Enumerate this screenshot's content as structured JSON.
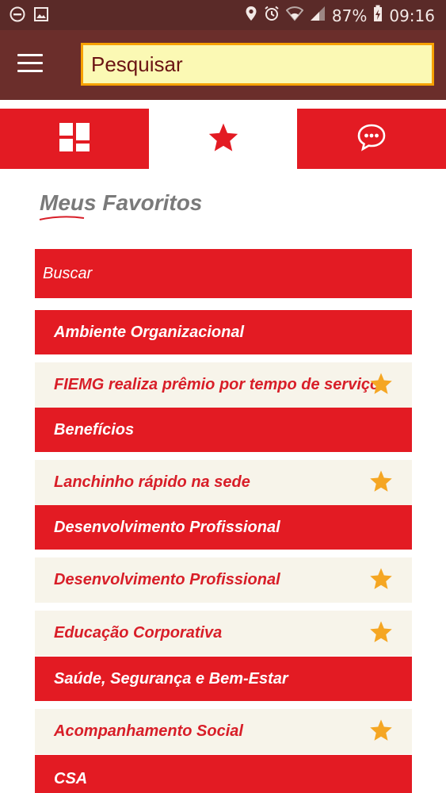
{
  "status_bar": {
    "battery": "87%",
    "time": "09:16",
    "icons": [
      "do-not-disturb-icon",
      "image-icon",
      "location-icon",
      "alarm-icon",
      "wifi-icon",
      "signal-icon",
      "battery-charging-icon"
    ]
  },
  "app_bar": {
    "menu_icon": "hamburger-menu-icon",
    "search": {
      "placeholder": "Pesquisar",
      "value": ""
    }
  },
  "tabs": [
    {
      "icon": "grid-icon",
      "active": false
    },
    {
      "icon": "star-icon",
      "active": true
    },
    {
      "icon": "chat-bubble-icon",
      "active": false
    }
  ],
  "section": {
    "title": "Meus Favoritos"
  },
  "favorites": [
    {
      "label": "Buscar",
      "style": "red",
      "starred": false
    },
    {
      "label": "Ambiente Organizacional",
      "style": "red",
      "starred": false
    },
    {
      "label": "FIEMG realiza prêmio por tempo de serviço",
      "style": "cream",
      "starred": true
    },
    {
      "label": "Benefícios",
      "style": "red",
      "starred": false
    },
    {
      "label": "Lanchinho rápido na sede",
      "style": "cream",
      "starred": true
    },
    {
      "label": "Desenvolvimento Profissional",
      "style": "red",
      "starred": false
    },
    {
      "label": "Desenvolvimento Profissional",
      "style": "cream",
      "starred": true
    },
    {
      "label": "Educação Corporativa",
      "style": "cream",
      "starred": true
    },
    {
      "label": "Saúde, Segurança e Bem-Estar",
      "style": "red",
      "starred": false
    },
    {
      "label": "Acompanhamento Social",
      "style": "cream",
      "starred": true
    },
    {
      "label": "CSA",
      "style": "red",
      "starred": false
    }
  ],
  "colors": {
    "status_bar": "#5a2a28",
    "app_bar": "#6b2e2b",
    "brand_red": "#e31b23",
    "cream": "#f7f4ea",
    "star_gold": "#f5a623",
    "search_border": "#f7a100",
    "search_fill": "#fbf9b4"
  }
}
